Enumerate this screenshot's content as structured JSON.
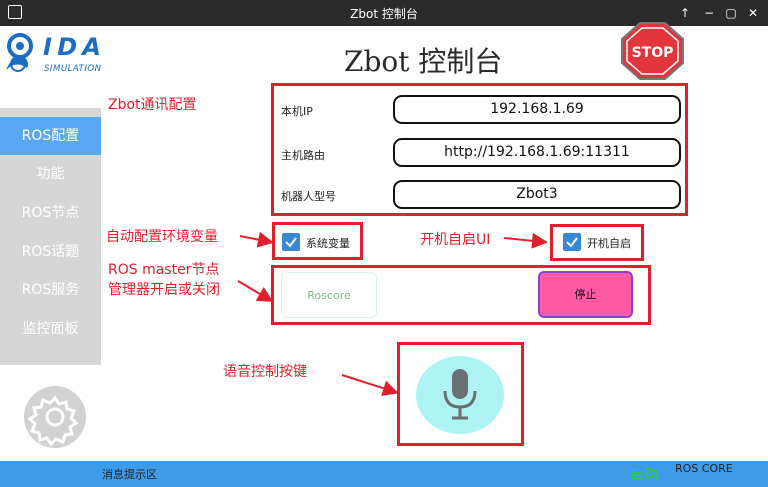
{
  "window": {
    "title": "Zbot 控制台",
    "buttons": [
      "↑",
      "−",
      "▢",
      "✕"
    ]
  },
  "logo": {
    "text": "IDA",
    "subtext": "SIMULATION"
  },
  "sidebar": {
    "items": [
      {
        "label": "ROS配置",
        "active": true
      },
      {
        "label": "功能"
      },
      {
        "label": "ROS节点"
      },
      {
        "label": "ROS话题"
      },
      {
        "label": "ROS服务"
      },
      {
        "label": "监控面板"
      }
    ]
  },
  "main": {
    "title": "Zbot 控制台",
    "stop_sign": "STOP"
  },
  "annotations": {
    "comm_config": "Zbot通讯配置",
    "env_vars": "自动配置环境变量",
    "autostart": "开机自启UI",
    "master_line1": "ROS master节点",
    "master_line2": "管理器开启或关闭",
    "voice": "语音控制按键"
  },
  "config": {
    "ip_label": "本机IP",
    "ip_value": "192.168.1.69",
    "route_label": "主机路由",
    "route_value": "http://192.168.1.69:11311",
    "model_label": "机器人型号",
    "model_value": "Zbot3"
  },
  "checkboxes": {
    "env_label": "系统变量",
    "autostart_label": "开机自启"
  },
  "master": {
    "roscore_label": "Roscore",
    "stop_label": "停止"
  },
  "status": {
    "message_area": "消息提示区",
    "indicator": "启动",
    "ros_core": "ROS CORE"
  },
  "colors": {
    "accent": "#58a7f0",
    "annotation": "#e0202c",
    "stop_button": "#ff5aa6",
    "status_bar": "#3d9be9"
  }
}
